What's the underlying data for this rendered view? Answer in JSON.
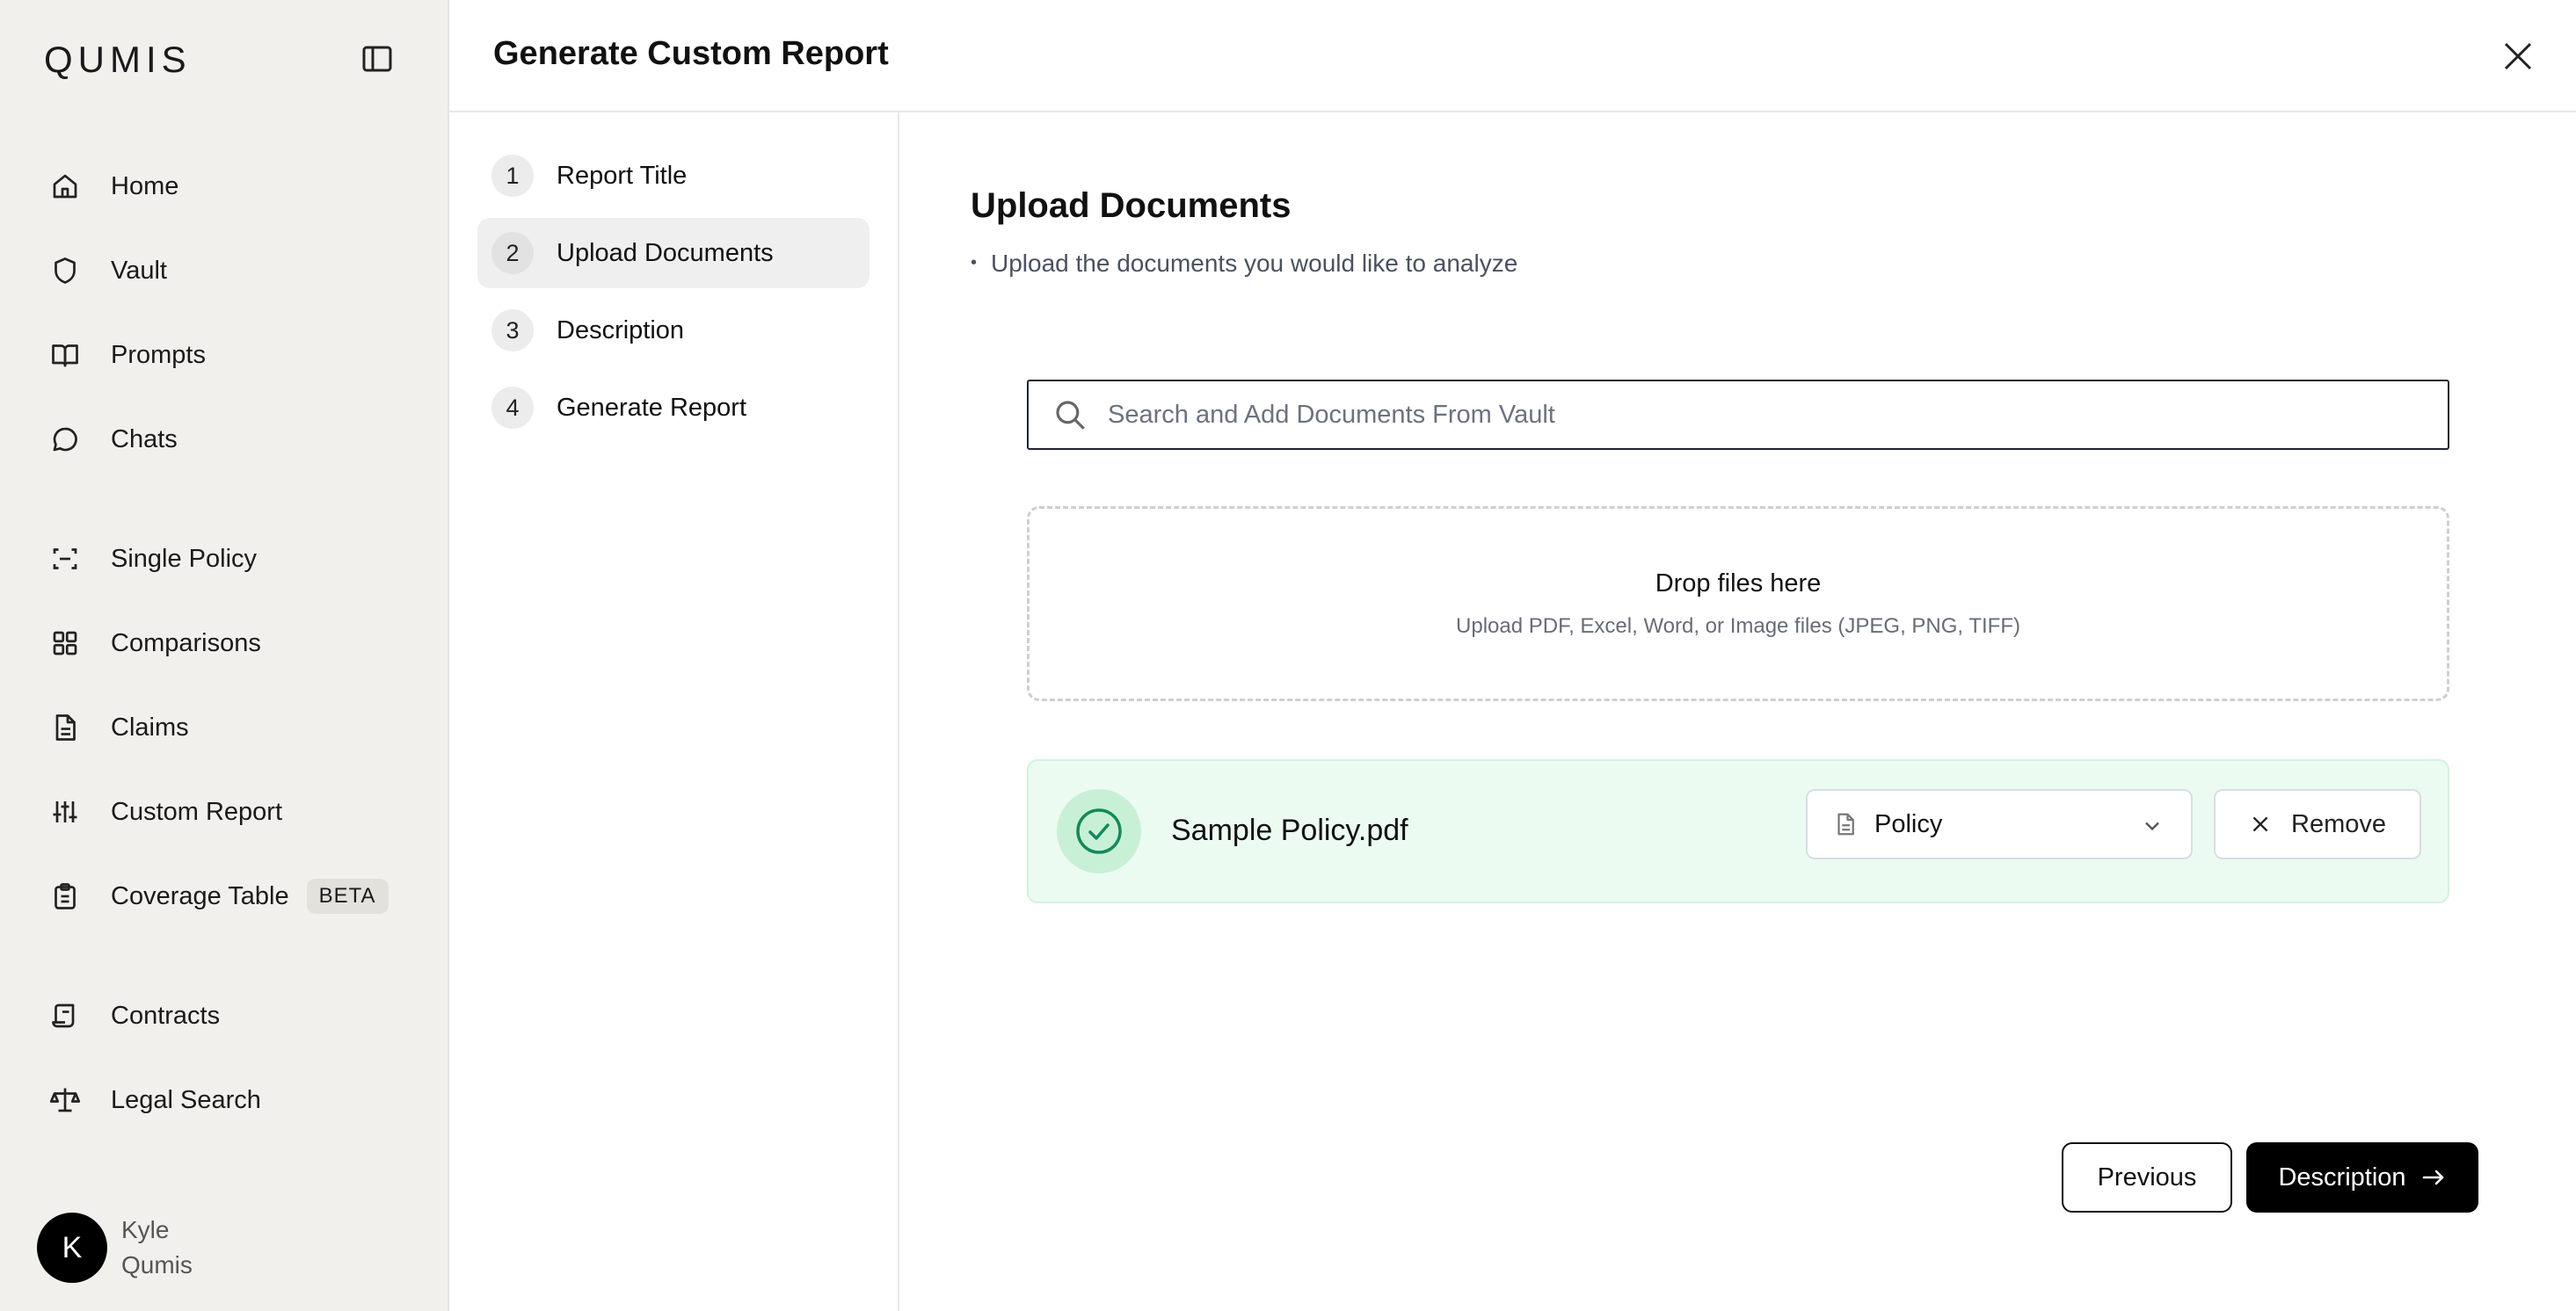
{
  "app": {
    "logo": "QUMIS"
  },
  "sidebar": {
    "items": [
      {
        "label": "Home",
        "icon": "home-icon"
      },
      {
        "label": "Vault",
        "icon": "shield-icon"
      },
      {
        "label": "Prompts",
        "icon": "book-icon"
      },
      {
        "label": "Chats",
        "icon": "chat-icon"
      },
      {
        "label": "Single Policy",
        "icon": "scan-icon"
      },
      {
        "label": "Comparisons",
        "icon": "grid-icon"
      },
      {
        "label": "Claims",
        "icon": "file-text-icon"
      },
      {
        "label": "Custom Report",
        "icon": "sliders-icon"
      },
      {
        "label": "Coverage Table",
        "icon": "clipboard-icon",
        "badge": "BETA"
      },
      {
        "label": "Contracts",
        "icon": "scroll-icon"
      },
      {
        "label": "Legal Search",
        "icon": "scale-icon"
      }
    ],
    "user": {
      "initial": "K",
      "first_name": "Kyle",
      "last_name": "Qumis"
    }
  },
  "header": {
    "title": "Generate Custom Report"
  },
  "steps": [
    {
      "num": "1",
      "label": "Report Title",
      "active": false
    },
    {
      "num": "2",
      "label": "Upload Documents",
      "active": true
    },
    {
      "num": "3",
      "label": "Description",
      "active": false
    },
    {
      "num": "4",
      "label": "Generate Report",
      "active": false
    }
  ],
  "main": {
    "title": "Upload Documents",
    "subtitle": "Upload the documents you would like to analyze",
    "search_placeholder": "Search and Add Documents From Vault",
    "dropzone": {
      "title": "Drop files here",
      "subtitle": "Upload PDF, Excel, Word, or Image files (JPEG, PNG, TIFF)"
    },
    "file": {
      "name": "Sample Policy.pdf",
      "type": "Policy",
      "remove_label": "Remove",
      "status": "uploaded"
    }
  },
  "footer": {
    "previous_label": "Previous",
    "next_label": "Description"
  },
  "colors": {
    "sidebar_bg": "#f1f0ed",
    "accent": "#000000",
    "success_bg": "#ecfbf2",
    "success_icon": "#12895a"
  }
}
